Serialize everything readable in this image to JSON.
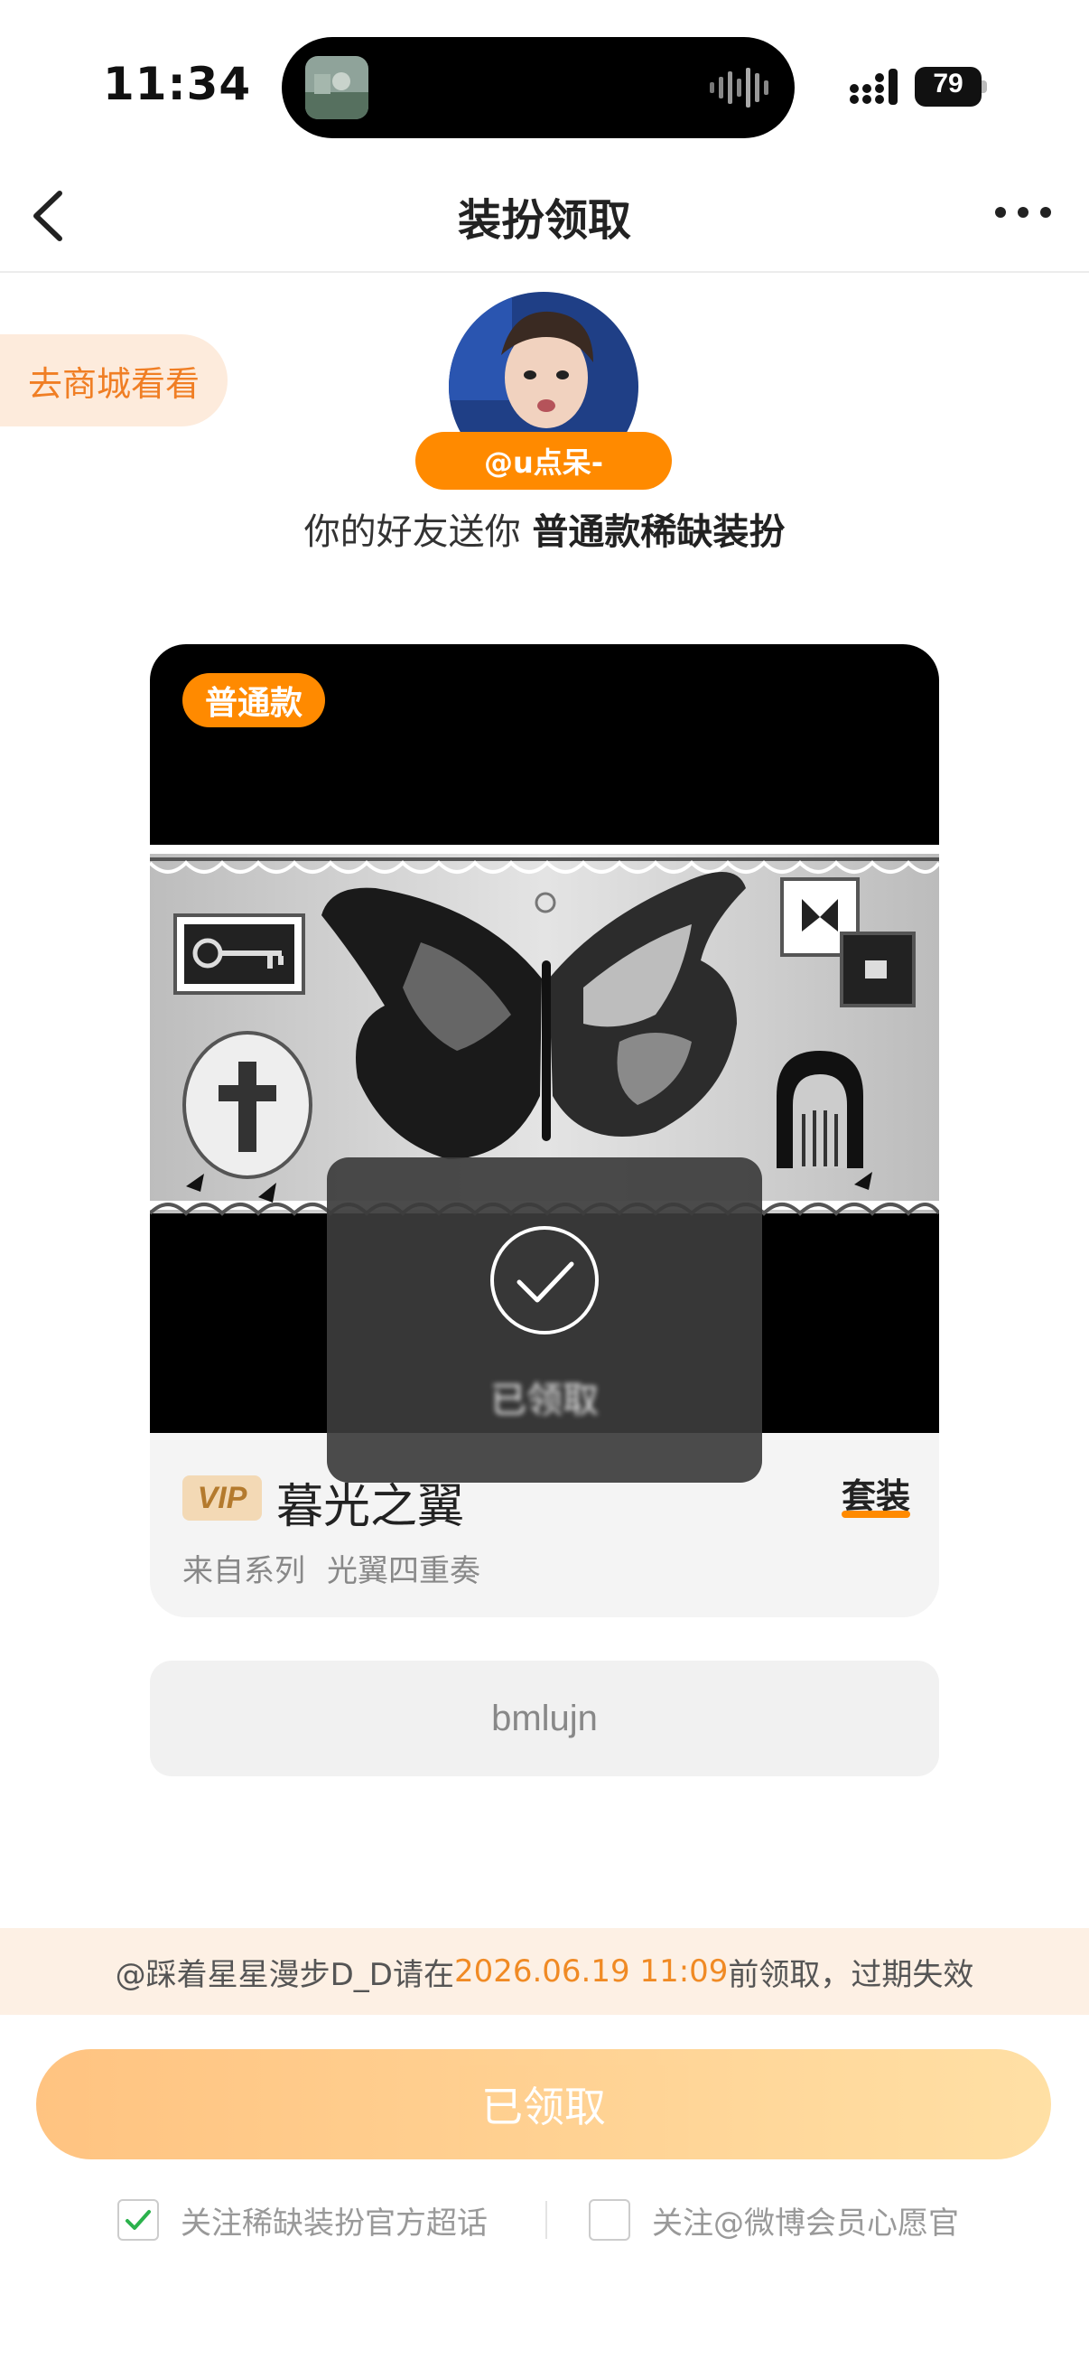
{
  "status_bar": {
    "time": "11:34",
    "battery": "79"
  },
  "nav": {
    "title": "装扮领取"
  },
  "shop_pill": {
    "label": "去商城看看"
  },
  "sender": {
    "name": "@u点呆-",
    "gift_prefix": "你的好友送你 ",
    "gift_highlight": "普通款稀缺装扮"
  },
  "card": {
    "tag": "普通款",
    "vip_label": "VIP",
    "item_name": "暮光之翼",
    "suit_label": "套装",
    "series_label": "来自系列",
    "series_name": "光翼四重奏"
  },
  "toast": {
    "text": "已领取"
  },
  "code": {
    "value": "bmlujn"
  },
  "notice": {
    "prefix": "@踩着星星漫步D_D请在",
    "date": "2026.06.19 11:09",
    "suffix": "前领取，过期失效"
  },
  "claim_button": {
    "label": "已领取"
  },
  "follow": [
    {
      "label": "关注稀缺装扮官方超话",
      "checked": true
    },
    {
      "label": "关注@微博会员心愿官",
      "checked": false
    }
  ],
  "colors": {
    "accent": "#ff8a00",
    "check": "#2bb24c"
  }
}
